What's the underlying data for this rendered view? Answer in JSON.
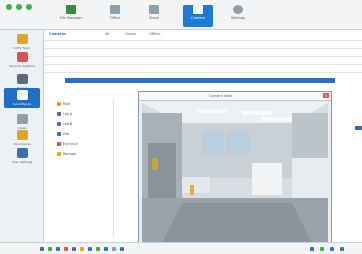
{
  "toolbar": {
    "buttons": [
      {
        "label": "File Manager",
        "icon": "folder-icon",
        "color": "#3d8b3d"
      },
      {
        "label": "Office",
        "icon": "office-icon",
        "color": "#7a8a99"
      },
      {
        "label": "Share",
        "icon": "share-icon",
        "color": "#7a8a99"
      },
      {
        "label": "Camera",
        "icon": "camera-icon",
        "color": "#ffffff",
        "selected": true
      },
      {
        "label": "Settings",
        "icon": "gear-icon",
        "color": "#7a8a99"
      }
    ]
  },
  "sidebar": {
    "items": [
      {
        "label": "CCTV Team",
        "icon": "group-icon",
        "color": "#e0a526"
      },
      {
        "label": "Security Systems",
        "icon": "shield-icon",
        "color": "#d9534f"
      },
      {
        "label": "Project",
        "icon": "project-icon",
        "color": "#5b6c7e"
      },
      {
        "label": "Surveillance",
        "icon": "camera-icon",
        "color": "#ffffff",
        "selected": true
      },
      {
        "label": "Cases",
        "icon": "briefcase-icon",
        "color": "#7a8a99"
      },
      {
        "label": "Documents",
        "icon": "document-icon",
        "color": "#e0a526"
      },
      {
        "label": "User Settings",
        "icon": "user-icon",
        "color": "#3a6fb5"
      }
    ]
  },
  "main": {
    "header": "Cameras",
    "filters": [
      "All",
      "Online",
      "Offline"
    ],
    "tree": [
      "Root",
      "Lab A",
      "Lab B",
      "Hall",
      "Entrance",
      "Storage"
    ]
  },
  "viewer": {
    "title": "Camera View"
  },
  "colors": {
    "accent": "#1f7ad6",
    "bar": "#2a6fc2"
  }
}
